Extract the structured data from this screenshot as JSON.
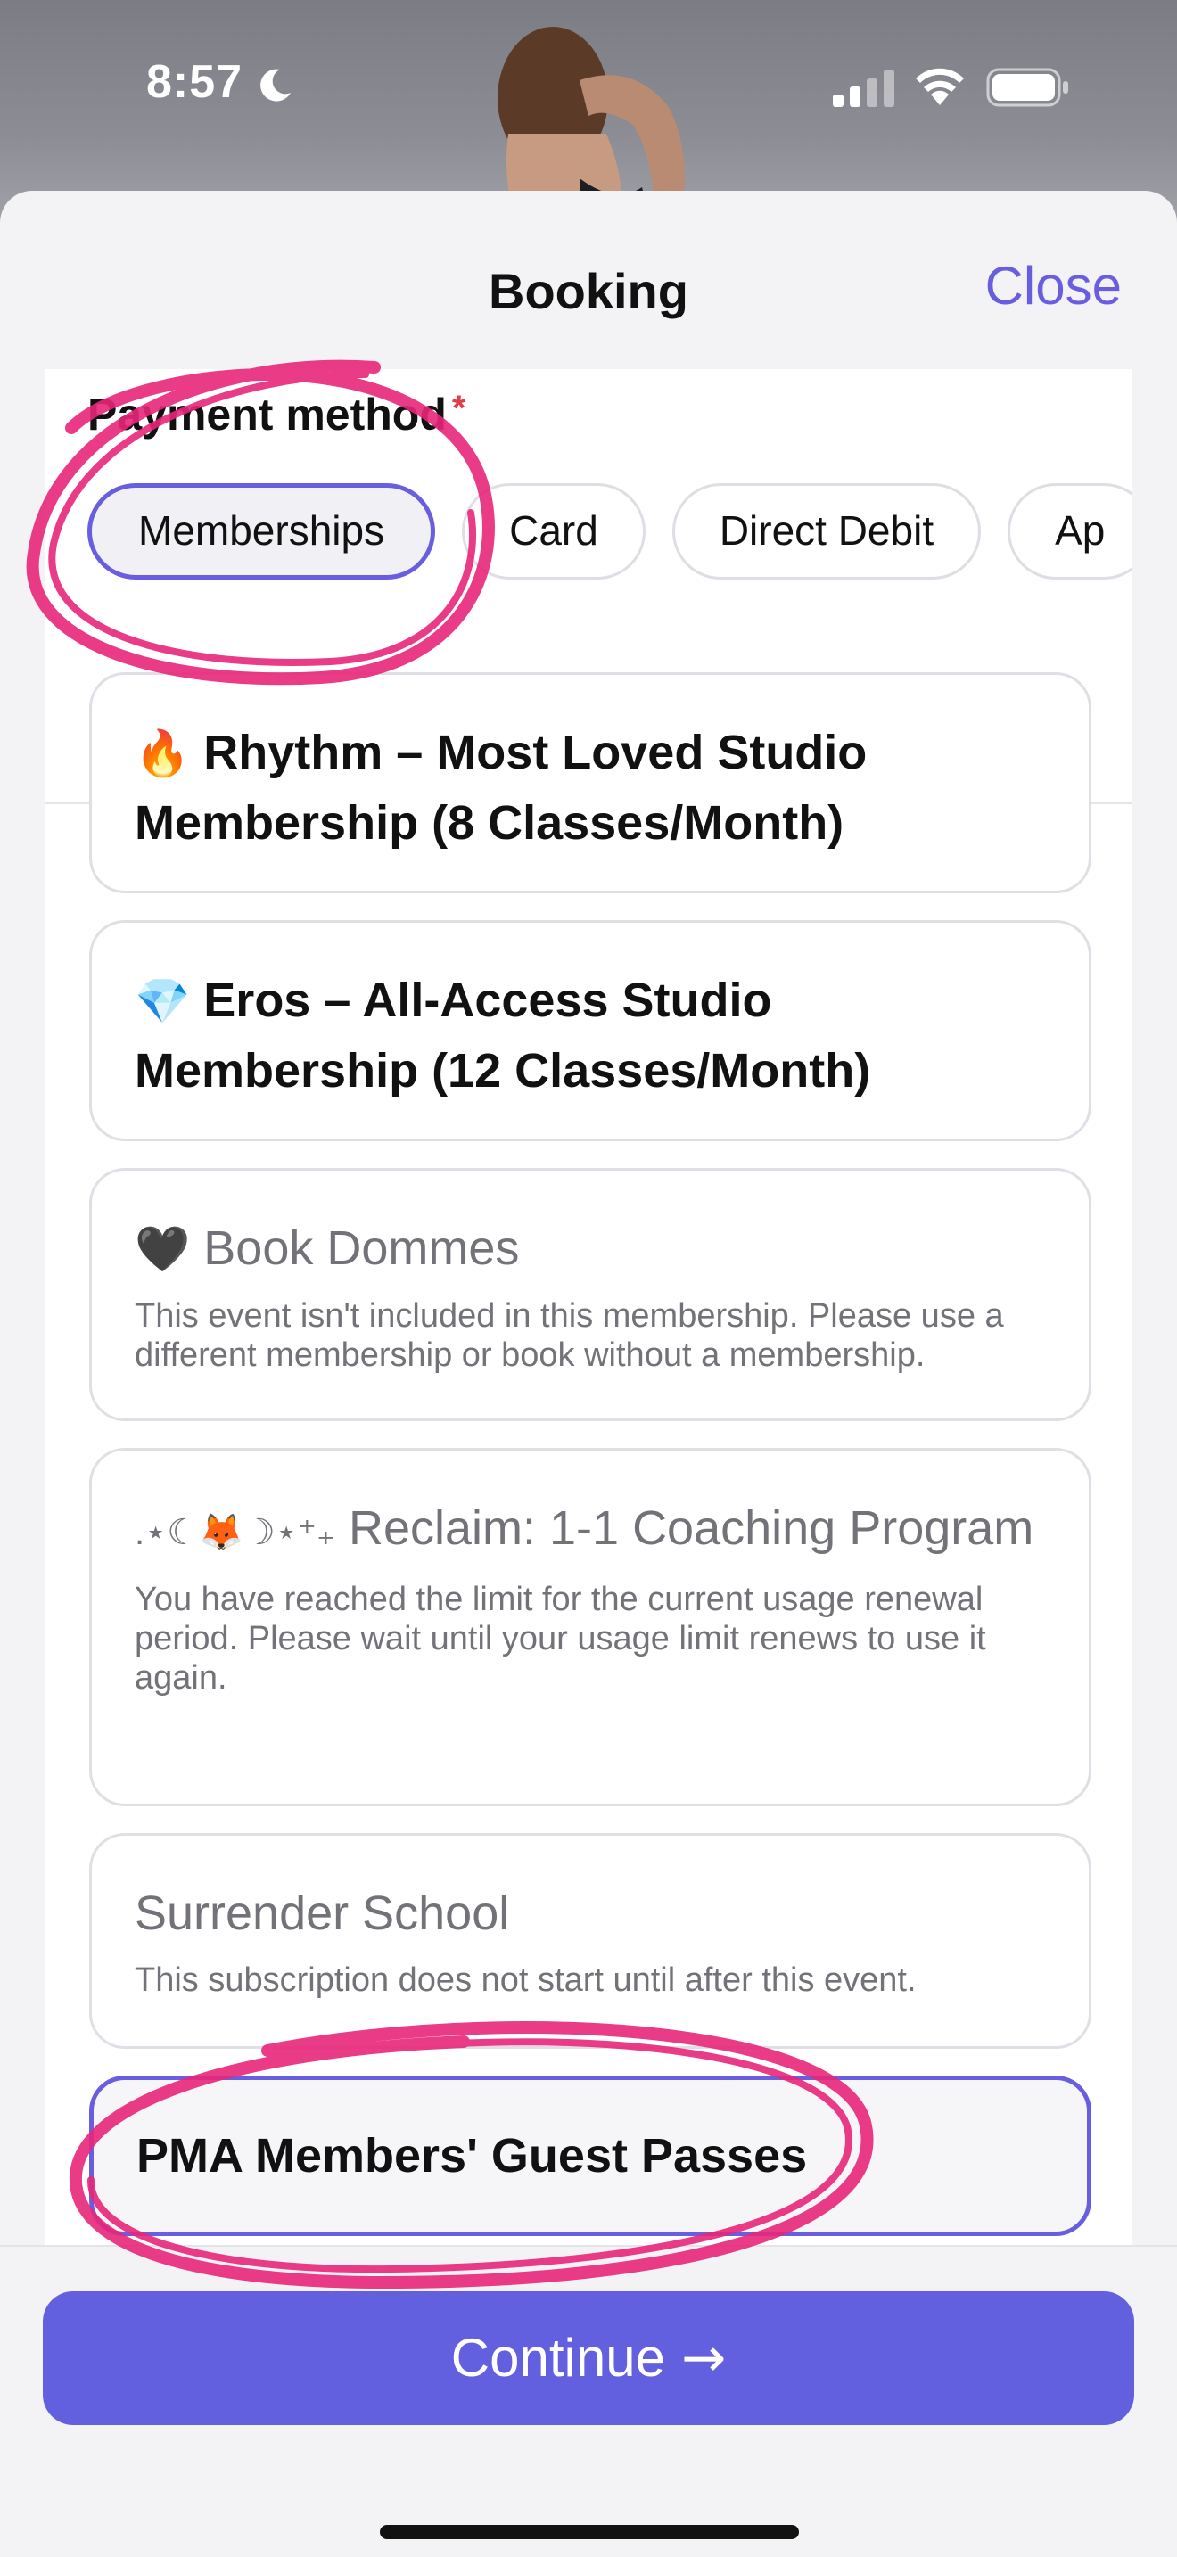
{
  "status_bar": {
    "time": "8:57"
  },
  "sheet": {
    "title": "Booking",
    "close_label": "Close"
  },
  "payment": {
    "label": "Payment method",
    "required_mark": "*",
    "methods": [
      "Memberships",
      "Card",
      "Direct Debit",
      "Ap"
    ],
    "selected_method": "Memberships"
  },
  "memberships": [
    {
      "emoji": "🔥",
      "title": "Rhythm – Most Loved Studio Membership (8 Classes/Month)",
      "note": "",
      "state": "available"
    },
    {
      "emoji": "💎",
      "title": "Eros – All-Access Studio Membership (12 Classes/Month)",
      "note": "",
      "state": "available"
    },
    {
      "emoji": "🖤",
      "title": "Book Dommes",
      "note": "This event isn't included in this membership. Please use a different membership or book without a membership.",
      "state": "disabled"
    },
    {
      "prefix": ".⋆☾🦊☽⋆⁺₊",
      "title": "Reclaim: 1-1 Coaching Program",
      "note": "You have reached the limit for the current usage renewal period. Please wait until your usage limit renews to use it again.",
      "state": "disabled"
    },
    {
      "title": "Surrender School",
      "note": "This subscription does not start until after this event.",
      "state": "disabled"
    },
    {
      "title": "PMA Members' Guest Passes",
      "note": "",
      "state": "selected"
    }
  ],
  "footer": {
    "continue_label": "Continue",
    "continue_arrow": "→"
  },
  "colors": {
    "accent": "#6360e0",
    "annotation": "#e8267a",
    "required": "#e23b4a"
  }
}
